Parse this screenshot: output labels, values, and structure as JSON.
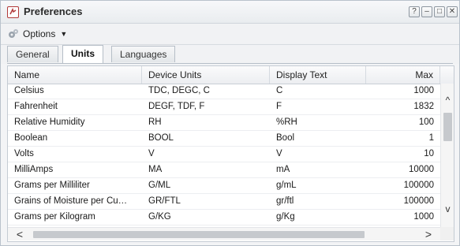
{
  "window": {
    "title": "Preferences",
    "buttons": {
      "help": "?",
      "minimize": "–",
      "maximize": "□",
      "close": "✕"
    }
  },
  "toolbar": {
    "options_label": "Options",
    "options_caret": "▼"
  },
  "tabs": [
    {
      "label": "General",
      "active": false
    },
    {
      "label": "Units",
      "active": true
    },
    {
      "label": "Languages",
      "active": false
    }
  ],
  "grid": {
    "columns": [
      "Name",
      "Device Units",
      "Display Text",
      "Max"
    ],
    "rows": [
      {
        "name": "Celsius",
        "device_units": "TDC, DEGC, C",
        "display_text": "C",
        "max": "1000"
      },
      {
        "name": "Fahrenheit",
        "device_units": "DEGF, TDF, F",
        "display_text": "F",
        "max": "1832"
      },
      {
        "name": "Relative Humidity",
        "device_units": "RH",
        "display_text": "%RH",
        "max": "100"
      },
      {
        "name": "Boolean",
        "device_units": "BOOL",
        "display_text": "Bool",
        "max": "1"
      },
      {
        "name": "Volts",
        "device_units": "V",
        "display_text": "V",
        "max": "10"
      },
      {
        "name": "MilliAmps",
        "device_units": "MA",
        "display_text": "mA",
        "max": "10000"
      },
      {
        "name": "Grams per Milliliter",
        "device_units": "G/ML",
        "display_text": "g/mL",
        "max": "100000"
      },
      {
        "name": "Grains of Moisture per Cu…",
        "device_units": "GR/FTL",
        "display_text": "gr/ftl",
        "max": "100000"
      },
      {
        "name": "Grams per Kilogram",
        "device_units": "G/KG",
        "display_text": "g/Kg",
        "max": "1000"
      }
    ]
  },
  "scrollbars": {
    "vertical": {
      "up": "^",
      "down": "v"
    },
    "horizontal": {
      "left": "<",
      "right": ">"
    }
  },
  "colors": {
    "app_icon": "#b23a3a",
    "border": "#c4cbd3",
    "scroll_thumb": "#c6c9cd"
  }
}
